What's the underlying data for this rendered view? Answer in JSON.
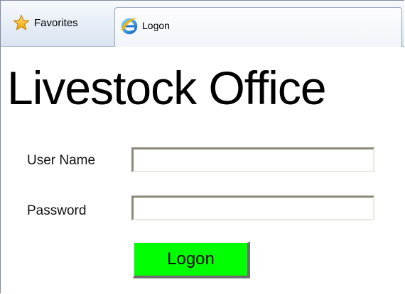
{
  "toolbar": {
    "favorites_label": "Favorites",
    "favorites_icon": "star-icon"
  },
  "tab": {
    "title": "Logon",
    "icon": "internet-explorer-icon"
  },
  "page": {
    "title": "Livestock Office"
  },
  "form": {
    "username_label": "User Name",
    "username_value": "",
    "password_label": "Password",
    "password_value": "",
    "submit_label": "Logon"
  },
  "colors": {
    "logon_button": "#00ff00"
  }
}
